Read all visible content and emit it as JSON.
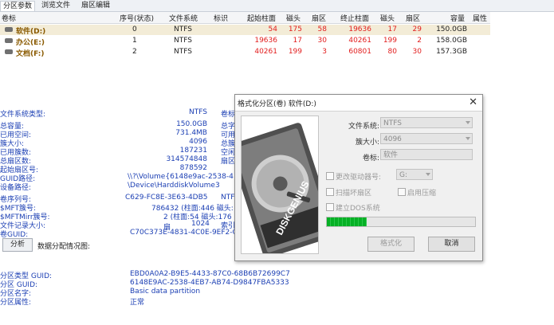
{
  "tabs": [
    "分区参数",
    "浏览文件",
    "扇区编辑"
  ],
  "table": {
    "headers": [
      "卷标",
      "序号(状态)",
      "文件系统",
      "标识",
      "起始柱面",
      "磁头",
      "扇区",
      "终止柱面",
      "磁头",
      "扇区",
      "容量",
      "属性"
    ],
    "rows": [
      {
        "name": "软件(D:)",
        "index": "0",
        "fs": "NTFS",
        "id": "",
        "start_cyl": "54",
        "start_head": "175",
        "start_sec": "58",
        "end_cyl": "19636",
        "end_head": "17",
        "end_sec": "29",
        "size": "150.0GB"
      },
      {
        "name": "办公(E:)",
        "index": "1",
        "fs": "NTFS",
        "id": "",
        "start_cyl": "19636",
        "start_head": "17",
        "start_sec": "30",
        "end_cyl": "40261",
        "end_head": "199",
        "end_sec": "2",
        "size": "158.0GB"
      },
      {
        "name": "文档(F:)",
        "index": "2",
        "fs": "NTFS",
        "id": "",
        "start_cyl": "40261",
        "start_head": "199",
        "start_sec": "3",
        "end_cyl": "60801",
        "end_head": "80",
        "end_sec": "30",
        "size": "157.3GB"
      }
    ]
  },
  "info": {
    "fs_type_label": "文件系统类型:",
    "fs_type_val": "NTFS",
    "vol_label_label": "卷标",
    "rows": [
      {
        "label": "总容量:",
        "value": "150.0GB",
        "r": "总字"
      },
      {
        "label": "已用空间:",
        "value": "731.4MB",
        "r": "可用"
      },
      {
        "label": "簇大小:",
        "value": "4096",
        "r": "总簇"
      },
      {
        "label": "已用簇数:",
        "value": "187231",
        "r": "空闲"
      },
      {
        "label": "总扇区数:",
        "value": "314574848",
        "r": "扇区"
      },
      {
        "label": "起始扇区号:",
        "value": "878592",
        "r": ""
      },
      {
        "label": "GUID路径:",
        "value": "\\\\?\\Volume{6148e9ac-2538-4",
        "r": ""
      },
      {
        "label": "设备路径:",
        "value": "\\Device\\HarddiskVolume3",
        "r": ""
      }
    ],
    "rows2": [
      {
        "label": "卷序列号:",
        "value": "C629-FC8E-3E63-4DB5",
        "r": "NTF"
      },
      {
        "label": "$MFT簇号:",
        "value": "786432 (柱面:446 磁头:",
        "r": ""
      },
      {
        "label": "$MFTMirr簇号:",
        "value": "2 (柱面:54 磁头:176 扇",
        "r": ""
      },
      {
        "label": "文件记录大小:",
        "value": "1024",
        "r": "索引"
      },
      {
        "label": "卷GUID:",
        "value": "C70C373E-4831-4C0E-9EF2-C",
        "r": ""
      }
    ]
  },
  "analyze_button": "分析",
  "alloc_label": "数据分配情况图:",
  "bottom": [
    {
      "label": "分区类型 GUID:",
      "value": "EBD0A0A2-B9E5-4433-87C0-68B6B72699C7"
    },
    {
      "label": "分区 GUID:",
      "value": "6148E9AC-2538-4EB7-AB74-D9847FBA5333"
    },
    {
      "label": "分区名字:",
      "value": "Basic data partition"
    },
    {
      "label": "分区属性:",
      "value": "正常"
    }
  ],
  "dialog": {
    "title": "格式化分区(卷) 软件(D:)",
    "brand_text": "DISKGENIUS",
    "fs_label": "文件系统:",
    "fs_value": "NTFS",
    "cluster_label": "簇大小:",
    "cluster_value": "4096",
    "vol_label": "卷标:",
    "vol_value": "软件",
    "drive_letter_label": "更改驱动器号:",
    "drive_letter_value": "G:",
    "scan_label": "扫描坏扇区",
    "compress_label": "启用压缩",
    "dos_label": "建立DOS系统",
    "progress": 0.27,
    "format_button": "格式化",
    "cancel_button": "取消",
    "close_icon": "close-icon"
  },
  "colors": {
    "accent_red": "#e21d1d",
    "label_blue": "#1d40b4",
    "progress_green": "#06b025"
  }
}
